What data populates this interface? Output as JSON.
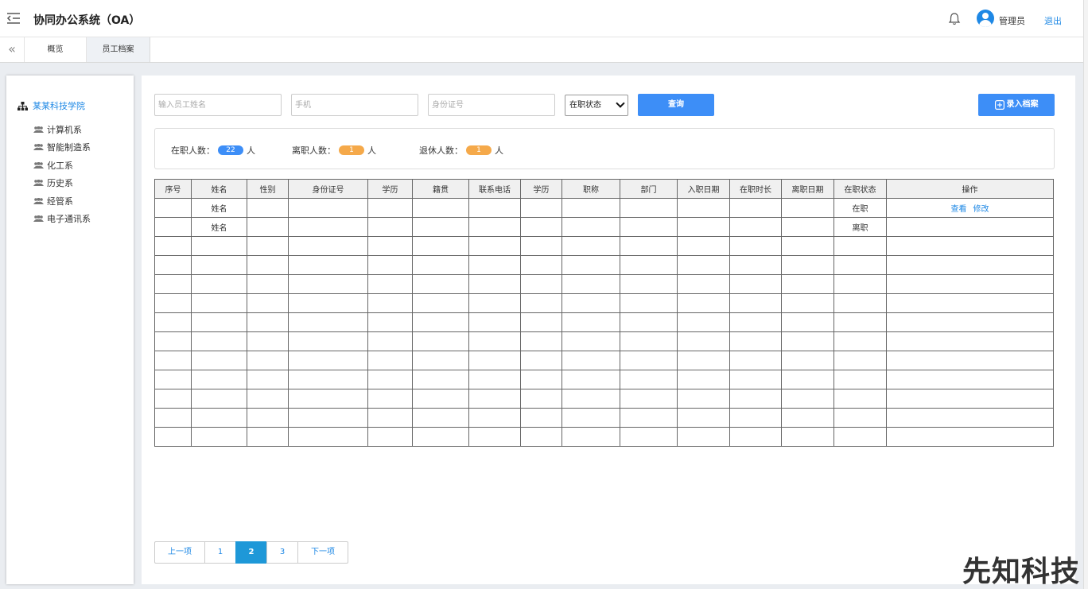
{
  "header": {
    "title": "协同办公系统（OA）",
    "username": "管理员",
    "logout": "退出"
  },
  "tabs": [
    {
      "label": "概览"
    },
    {
      "label": "员工档案"
    }
  ],
  "sidebar": {
    "root": "某某科技学院",
    "items": [
      {
        "label": "计算机系"
      },
      {
        "label": "智能制造系"
      },
      {
        "label": "化工系"
      },
      {
        "label": "历史系"
      },
      {
        "label": "经管系"
      },
      {
        "label": "电子通讯系"
      }
    ]
  },
  "filters": {
    "name_placeholder": "输入员工姓名",
    "phone_placeholder": "手机",
    "id_placeholder": "身份证号",
    "status_selected": "在职状态",
    "query_label": "查询",
    "add_label": "录入档案"
  },
  "stats": {
    "active_label": "在职人数：",
    "active_count": "22",
    "left_label": "离职人数：",
    "left_count": "1",
    "retired_label": "退休人数：",
    "retired_count": "1",
    "unit": "人"
  },
  "table": {
    "headers": [
      "序号",
      "姓名",
      "性别",
      "身份证号",
      "学历",
      "籍贯",
      "联系电话",
      "学历",
      "职称",
      "部门",
      "入职日期",
      "在职时长",
      "离职日期",
      "在职状态",
      "操作"
    ],
    "rows": [
      {
        "name": "姓名",
        "status": "在职",
        "status_type": "on",
        "actions": [
          "查看",
          "修改"
        ]
      },
      {
        "name": "姓名",
        "status": "离职",
        "status_type": "off",
        "actions": []
      }
    ],
    "empty_rows": 11
  },
  "pager": {
    "prev": "上一项",
    "pages": [
      "1",
      "2",
      "3"
    ],
    "current": "2",
    "next": "下一项"
  },
  "watermark": "先知科技",
  "colors": {
    "primary": "#3d8ef7",
    "active_status": "#1aa34a",
    "left_status": "#f0a23c",
    "badge_orange": "#f5a94a"
  }
}
